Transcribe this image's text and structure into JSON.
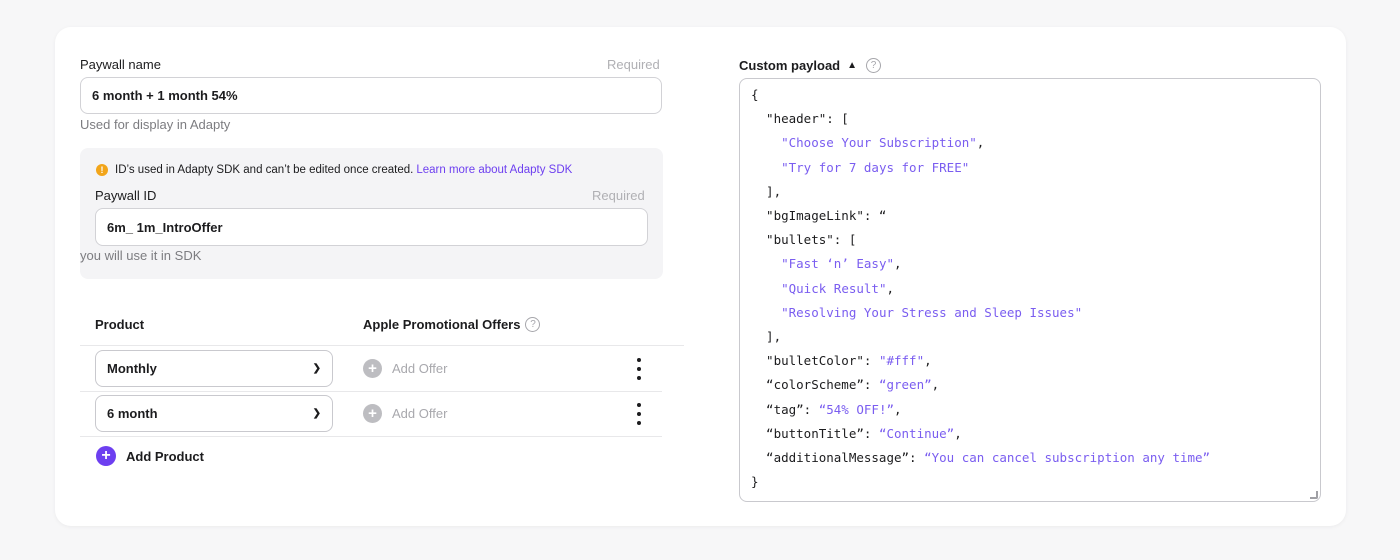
{
  "paywall": {
    "name_label": "Paywall name",
    "name_required": "Required",
    "name_value": "6 month + 1 month 54%",
    "name_helper": "Used for display in Adapty",
    "id_info": "ID’s used in Adapty SDK and can’t be edited once created.",
    "id_info_link": "Learn more about Adapty SDK",
    "id_label": "Paywall ID",
    "id_required": "Required",
    "id_value": "6m_ 1m_IntroOffer",
    "id_helper": "you will use it in SDK"
  },
  "products": {
    "col_product": "Product",
    "col_offers": "Apple Promotional Offers",
    "rows": [
      {
        "product": "Monthly",
        "offer_label": "Add Offer"
      },
      {
        "product": "6 month",
        "offer_label": "Add Offer"
      }
    ],
    "add_product_label": "Add Product"
  },
  "payload": {
    "title": "Custom payload",
    "lines": [
      {
        "k": "{",
        "s": "",
        "t": ""
      },
      {
        "k": "  \"header\": [",
        "s": "",
        "t": ""
      },
      {
        "k": "    ",
        "s": "\"Choose Your Subscription\"",
        "t": ","
      },
      {
        "k": "    ",
        "s": "\"Try for 7 days for FREE\"",
        "t": ""
      },
      {
        "k": "  ],",
        "s": "",
        "t": ""
      },
      {
        "k": "  \"bgImageLink\": “",
        "s": "",
        "t": ""
      },
      {
        "k": "  \"bullets\": [",
        "s": "",
        "t": ""
      },
      {
        "k": "    ",
        "s": "\"Fast ‘n’ Easy\"",
        "t": ","
      },
      {
        "k": "    ",
        "s": "\"Quick Result\"",
        "t": ","
      },
      {
        "k": "    ",
        "s": "\"Resolving Your Stress and Sleep Issues\"",
        "t": ""
      },
      {
        "k": "  ],",
        "s": "",
        "t": ""
      },
      {
        "k": "  \"bulletColor\": ",
        "s": "\"#fff\"",
        "t": ","
      },
      {
        "k": "  “colorScheme”: ",
        "s": "“green”",
        "t": ","
      },
      {
        "k": "  “tag”: ",
        "s": "“54% OFF!”",
        "t": ","
      },
      {
        "k": "  “buttonTitle”: ",
        "s": "“Continue”",
        "t": ","
      },
      {
        "k": "  “additionalMessage”: ",
        "s": "“You can cancel subscription any time”",
        "t": ""
      },
      {
        "k": "}",
        "s": "",
        "t": ""
      }
    ]
  },
  "colors": {
    "accent": "#6d3ff0",
    "warning": "#f2a51a",
    "string": "#7a5df0"
  }
}
